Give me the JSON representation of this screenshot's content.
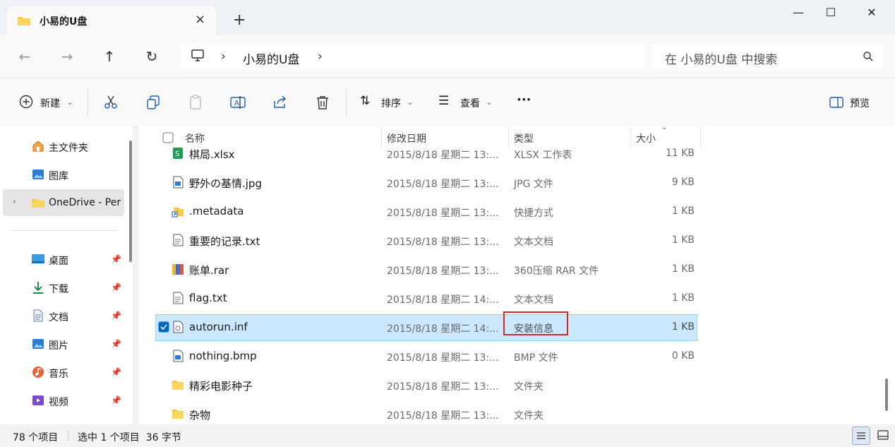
{
  "window": {
    "tab_title": "小易的U盘",
    "tab_close": "×",
    "new_tab": "+",
    "minimize": "—",
    "maximize": "☐",
    "close": "✕"
  },
  "address": {
    "crumbs": [
      "小易的U盘"
    ],
    "search_placeholder": "在 小易的U盘 中搜索"
  },
  "toolbar": {
    "new_label": "新建",
    "sort_label": "排序",
    "view_label": "查看",
    "more_label": "···",
    "preview_label": "预览"
  },
  "sidebar": {
    "items": [
      {
        "label": "主文件夹",
        "icon": "home-icon"
      },
      {
        "label": "图库",
        "icon": "gallery-icon"
      },
      {
        "label": "OneDrive - Per",
        "icon": "folder-icon"
      },
      {
        "label": "桌面",
        "icon": "desktop-icon"
      },
      {
        "label": "下载",
        "icon": "download-icon"
      },
      {
        "label": "文档",
        "icon": "document-icon"
      },
      {
        "label": "图片",
        "icon": "pictures-icon"
      },
      {
        "label": "音乐",
        "icon": "music-icon"
      },
      {
        "label": "视频",
        "icon": "video-icon"
      }
    ]
  },
  "columns": {
    "name": "名称",
    "date": "修改日期",
    "type": "类型",
    "size": "大小"
  },
  "files": [
    {
      "name": "棋局.xlsx",
      "date": "2015/8/18 星期二 13:...",
      "type": "XLSX 工作表",
      "size": "11 KB",
      "icon": "excel-file-icon"
    },
    {
      "name": "野外の基情.jpg",
      "date": "2015/8/18 星期二 13:...",
      "type": "JPG 文件",
      "size": "9 KB",
      "icon": "image-file-icon"
    },
    {
      "name": ".metadata",
      "date": "2015/8/18 星期二 13:...",
      "type": "快捷方式",
      "size": "1 KB",
      "icon": "shortcut-icon"
    },
    {
      "name": "重要的记录.txt",
      "date": "2015/8/18 星期二 13:...",
      "type": "文本文档",
      "size": "1 KB",
      "icon": "text-file-icon"
    },
    {
      "name": "账单.rar",
      "date": "2015/8/18 星期二 13:...",
      "type": "360压缩 RAR 文件",
      "size": "1 KB",
      "icon": "archive-file-icon"
    },
    {
      "name": "flag.txt",
      "date": "2015/8/18 星期二 14:...",
      "type": "文本文档",
      "size": "1 KB",
      "icon": "text-file-icon"
    },
    {
      "name": "autorun.inf",
      "date": "2015/8/18 星期二 14:...",
      "type": "安装信息",
      "size": "1 KB",
      "icon": "setup-info-file-icon"
    },
    {
      "name": "nothing.bmp",
      "date": "2015/8/18 星期二 13:...",
      "type": "BMP 文件",
      "size": "0 KB",
      "icon": "image-file-icon"
    },
    {
      "name": "精彩电影种子",
      "date": "2015/8/18 星期二 13:...",
      "type": "文件夹",
      "size": "",
      "icon": "folder-icon"
    },
    {
      "name": "杂物",
      "date": "2015/8/18 星期二 13:...",
      "type": "文件夹",
      "size": "",
      "icon": "folder-icon"
    }
  ],
  "selected_index": 6,
  "status": {
    "count": "78 个项目",
    "selection": "选中 1 个项目  36 字节"
  },
  "colors": {
    "selection": "#cce8ff",
    "highlight_box": "#e0222a",
    "accent": "#0067c0"
  }
}
